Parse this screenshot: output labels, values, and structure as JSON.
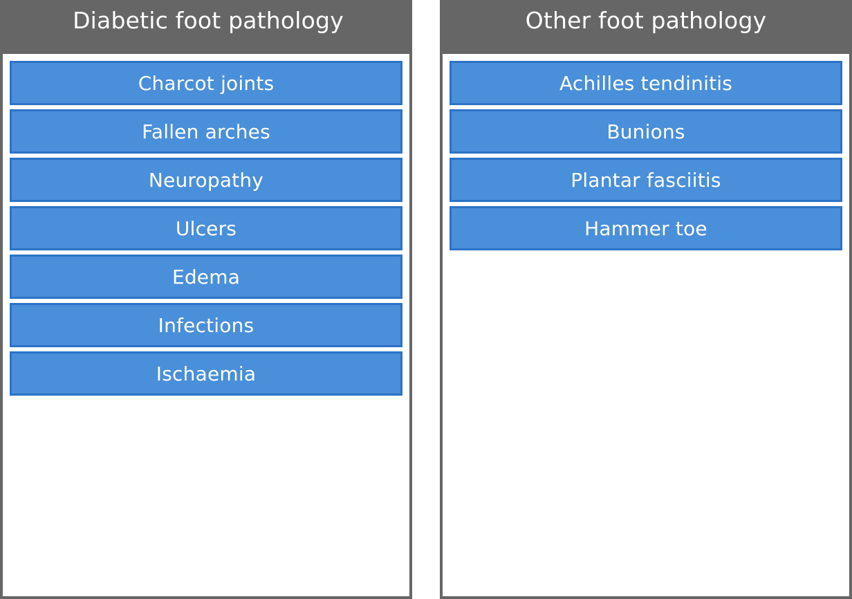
{
  "columns": [
    {
      "title": "Diabetic foot pathology",
      "items": [
        "Charcot joints",
        "Fallen arches",
        "Neuropathy",
        "Ulcers",
        "Edema",
        "Infections",
        "Ischaemia"
      ]
    },
    {
      "title": "Other foot pathology",
      "items": [
        "Achilles tendinitis",
        "Bunions",
        "Plantar fasciitis",
        "Hammer toe"
      ]
    }
  ],
  "colors": {
    "header_bg": "#666666",
    "item_bg": "#4a8fd9",
    "item_border": "#2b73c7",
    "text": "#ffffff"
  }
}
